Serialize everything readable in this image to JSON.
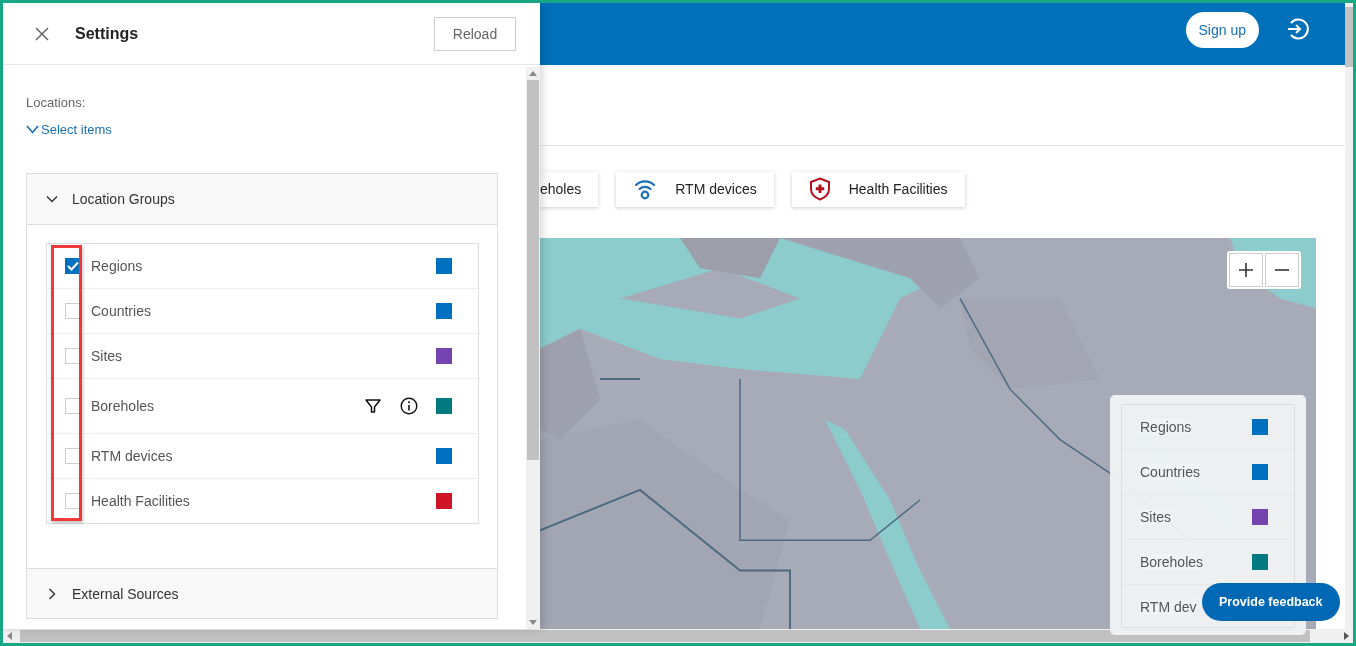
{
  "settings_panel": {
    "title": "Settings",
    "reload_button": "Reload",
    "locations_label": "Locations:",
    "select_items_link": "Select items",
    "sections": [
      {
        "title": "Location Groups",
        "expanded": true,
        "items": [
          {
            "label": "Regions",
            "checked": true,
            "color": "#0070c0",
            "kind": "plain"
          },
          {
            "label": "Countries",
            "checked": false,
            "color": "#0070c0",
            "kind": "plain"
          },
          {
            "label": "Sites",
            "checked": false,
            "color": "#7444b0",
            "kind": "plain"
          },
          {
            "label": "Boreholes",
            "checked": false,
            "color": "#007a80",
            "kind": "filterable"
          },
          {
            "label": "RTM devices",
            "checked": false,
            "color": "#0070c0",
            "kind": "plain"
          },
          {
            "label": "Health Facilities",
            "checked": false,
            "color": "#d01427",
            "kind": "plain"
          }
        ]
      },
      {
        "title": "External Sources",
        "expanded": false
      }
    ]
  },
  "header": {
    "sign_up_button": "Sign up"
  },
  "layer_tabs": [
    {
      "label": "eholes",
      "kind": "plain"
    },
    {
      "label": "RTM devices",
      "kind": "signal"
    },
    {
      "label": "Health Facilities",
      "kind": "medical"
    }
  ],
  "map": {
    "legend": [
      {
        "label": "Regions",
        "color": "#0070c0"
      },
      {
        "label": "Countries",
        "color": "#0070c0"
      },
      {
        "label": "Sites",
        "color": "#7444b0"
      },
      {
        "label": "Boreholes",
        "color": "#007a80"
      },
      {
        "label": "RTM dev"
      }
    ]
  },
  "feedback_button": "Provide feedback"
}
